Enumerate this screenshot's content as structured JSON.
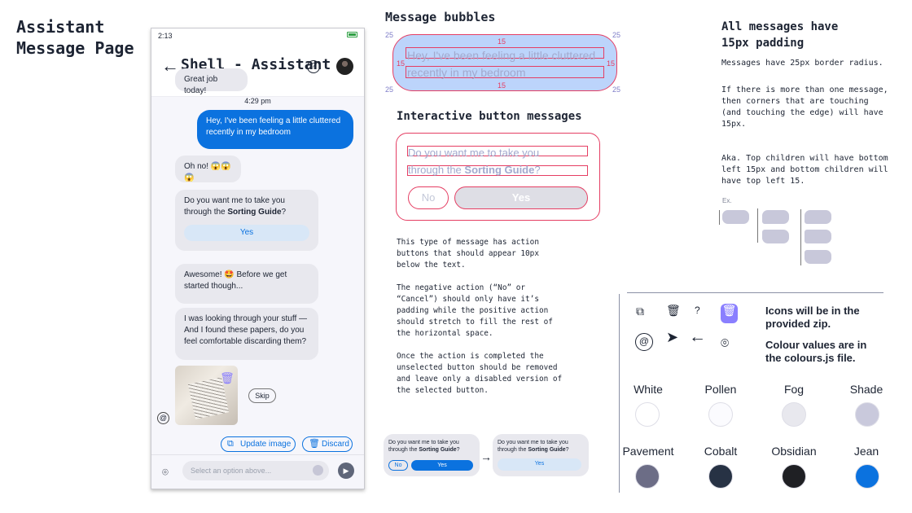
{
  "page_title": [
    "Assistant",
    "Message Page"
  ],
  "phone": {
    "time": "2:13",
    "title": "Shell - Assistant",
    "help": "?",
    "messages": {
      "great": "Great job today!",
      "timestamp": "4:29 pm",
      "user": "Hey, I've been feeling a little cluttered recently in my bedroom",
      "oh_no": "Oh no! 😱😱😱",
      "question": "Do you want me to take you through the",
      "guide": "Sorting Guide",
      "question_end": "?",
      "yes": "Yes",
      "awesome": "Awesome! 🤩 Before we get started though...",
      "papers": "I was looking through your stuff — And I found these papers, do you feel comfortable discarding them?"
    },
    "skip": "Skip",
    "update_image": "Update image",
    "discard": "Discard",
    "composer_placeholder": "Select an option above...",
    "icons": {
      "back": "arrow-left-icon",
      "trash": "trash-icon",
      "camera": "camera-icon",
      "send": "send-icon"
    }
  },
  "bubbles": {
    "heading": "Message bubbles",
    "text_line_1": "Hey, I've been feeling a little cluttered",
    "text_line_2": "recently in my bedroom",
    "padding": "15",
    "radius": "25"
  },
  "interactive": {
    "heading": "Interactive button messages",
    "line_1": "Do you want me to take you",
    "line_2_prefix": "through the",
    "guide": "Sorting Guide",
    "question_end": "?",
    "no": "No",
    "yes": "Yes",
    "note": "This type of message has action buttons that should appear 10px below the text.\n\nThe negative action (“No” or “Cancel”) should only have it’s padding while the positive action should stretch to fill the rest of the horizontal space.\n\nOnce the action is completed the unselected button should be removed and leave only a disabled version of the selected button.",
    "before_text_1": "Do you want me to take you",
    "before_text_2": "through the",
    "before_guide": "Sorting Guide",
    "before_question_end": "?",
    "before_no": "No",
    "before_yes": "Yes",
    "after_yes": "Yes"
  },
  "rules": {
    "heading_line_1": "All messages have",
    "heading_line_2": "15px padding",
    "radius": "Messages have 25px border radius.",
    "corners": "If there is more than one message, then corners that are touching (and touching the edge) will have 15px.",
    "children": "Aka. Top children will have bottom left 15px and bottom children will have top left 15.",
    "example": "Ex."
  },
  "assets": {
    "icons_text": "Icons will be in the provided zip.",
    "colours_text": "Colour values are in the colours.js file."
  },
  "colors": [
    {
      "name": "White",
      "hex": "#ffffff"
    },
    {
      "name": "Pollen",
      "hex": "#fbfbfe"
    },
    {
      "name": "Fog",
      "hex": "#e8e8ee"
    },
    {
      "name": "Shade",
      "hex": "#c9c9dc"
    },
    {
      "name": "Pavement",
      "hex": "#6c6d86"
    },
    {
      "name": "Cobalt",
      "hex": "#273244"
    },
    {
      "name": "Obsidian",
      "hex": "#1f2024"
    },
    {
      "name": "Jean",
      "hex": "#0b72df"
    }
  ]
}
